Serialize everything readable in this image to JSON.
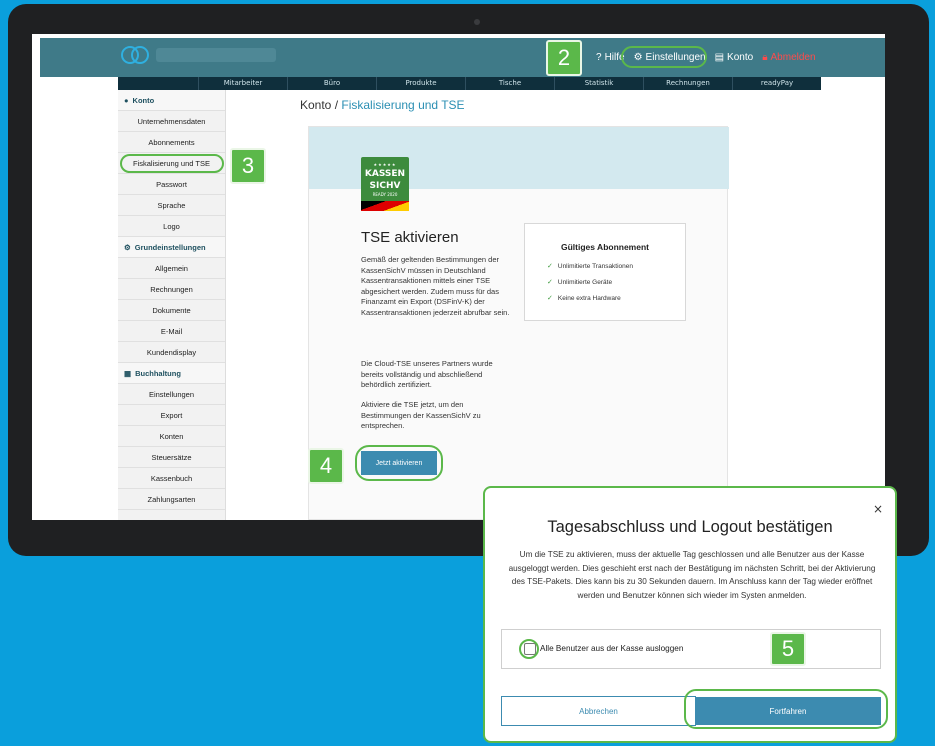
{
  "topnav": {
    "help": "Hilfe",
    "settings": "Einstellungen",
    "account": "Konto",
    "logout": "Abmelden"
  },
  "menubar": [
    "Mitarbeiter",
    "Büro",
    "Produkte",
    "Tische",
    "Statistik",
    "Rechnungen",
    "readyPay"
  ],
  "sidebar": {
    "sections": [
      {
        "title": "Konto",
        "icon": "person-icon",
        "items": [
          "Unternehmensdaten",
          "Abonnements",
          "Fiskalisierung und TSE",
          "Passwort",
          "Sprache",
          "Logo"
        ]
      },
      {
        "title": "Grundeinstellungen",
        "icon": "gears-icon",
        "items": [
          "Allgemein",
          "Rechnungen",
          "Dokumente",
          "E-Mail",
          "Kundendisplay"
        ]
      },
      {
        "title": "Buchhaltung",
        "icon": "calculator-icon",
        "items": [
          "Einstellungen",
          "Export",
          "Konten",
          "Steuersätze",
          "Kassenbuch",
          "Zahlungsarten"
        ]
      }
    ],
    "active_item": "Fiskalisierung und TSE"
  },
  "breadcrumb": {
    "root": "Konto",
    "sep": " / ",
    "current": "Fiskalisierung und TSE"
  },
  "badge": {
    "stars": "★★★★★",
    "line1": "KASSEN",
    "line2": "SICHV",
    "line3": "READY 2020"
  },
  "tse": {
    "title": "TSE aktivieren",
    "p1": "Gemäß der geltenden Bestimmungen der KassenSichV müssen in Deutschland Kassentransaktionen mittels einer TSE abgesichert werden. Zudem muss für das Finanzamt ein Export (DSFinV-K) der Kassentransaktionen jederzeit abrufbar sein.",
    "p2": "Die Cloud-TSE unseres Partners wurde bereits vollständig und abschließend behördlich zertifiziert.",
    "p3": "Aktiviere die TSE jetzt, um den Bestimmungen der KassenSichV zu entsprechen.",
    "button": "Jetzt aktivieren"
  },
  "subscription": {
    "title": "Gültiges Abonnement",
    "features": [
      "Unlimitierte Transaktionen",
      "Unlimitierte Geräte",
      "Keine extra Hardware"
    ]
  },
  "steps": [
    "2",
    "3",
    "4",
    "5"
  ],
  "modal": {
    "close": "×",
    "title": "Tagesabschluss und Logout bestätigen",
    "text": "Um die TSE zu aktivieren, muss der aktuelle Tag geschlossen und alle Benutzer aus der Kasse ausgeloggt werden. Dies geschieht erst nach der Bestätigung im nächsten Schritt, bei der Aktivierung des TSE-Pakets. Dies kann bis zu 30 Sekunden dauern. Im Anschluss kann der Tag wieder eröffnet werden und Benutzer können sich wieder im Systen anmelden.",
    "checkbox_label": "Alle Benutzer aus der Kasse ausloggen",
    "checkbox_checked": false,
    "cancel": "Abbrechen",
    "confirm": "Fortfahren"
  },
  "colors": {
    "highlight": "#5bb84a",
    "primary": "#3c8bb0",
    "background": "#0a9fdc",
    "logout": "#ff4b4b"
  }
}
